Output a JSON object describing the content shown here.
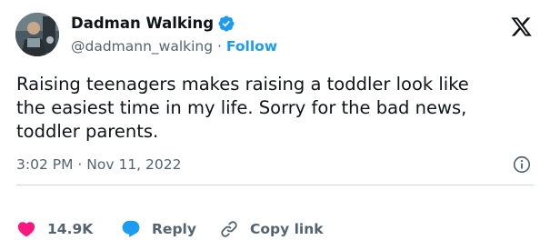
{
  "tweet": {
    "display_name": "Dadman Walking",
    "handle": "@dadmann_walking",
    "separator": "·",
    "follow_label": "Follow",
    "text": "Raising teenagers makes raising a toddler look like\nthe easiest time in my life. Sorry for the bad news,\ntoddler parents.",
    "time": "3:02 PM",
    "date": "Nov 11, 2022",
    "timestamp_separator": "·"
  },
  "actions": {
    "likes_count": "14.9K",
    "reply_label": "Reply",
    "copy_link_label": "Copy link"
  },
  "colors": {
    "accent": "#1d9bf0",
    "like": "#f91880",
    "text_primary": "#0f1419",
    "text_secondary": "#536471",
    "divider": "#cfd9de"
  },
  "icons": {
    "verified": "verified-badge-icon",
    "brand": "x-logo-icon",
    "info": "info-icon",
    "like": "heart-icon",
    "reply": "reply-bubble-icon",
    "copy_link": "link-icon"
  }
}
